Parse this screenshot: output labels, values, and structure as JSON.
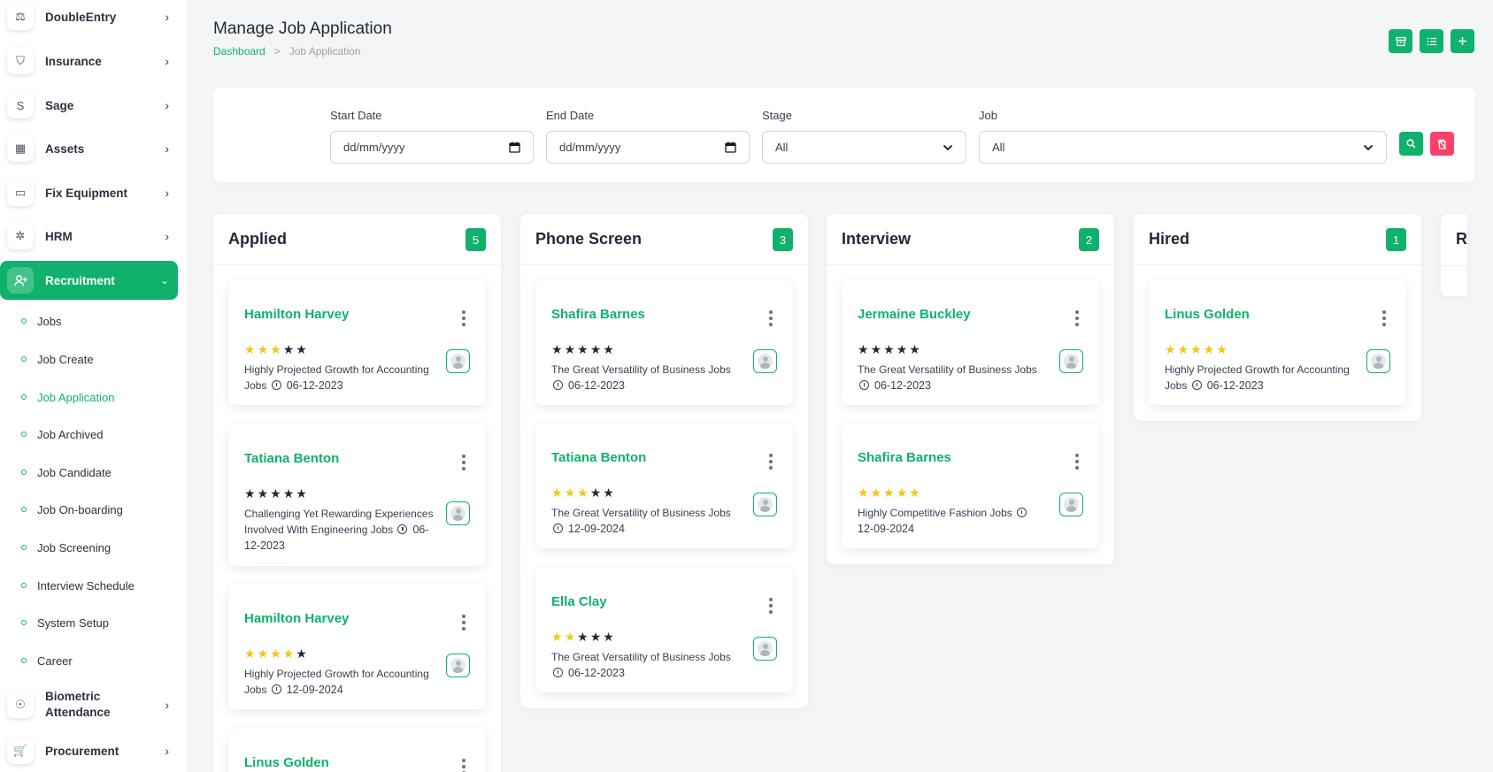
{
  "sidebar": {
    "items": [
      {
        "label": "DoubleEntry",
        "icon": "scale-icon",
        "glyph": "⚖"
      },
      {
        "label": "Insurance",
        "icon": "shield-icon",
        "glyph": "⛉"
      },
      {
        "label": "Sage",
        "icon": "sage-icon",
        "glyph": "S"
      },
      {
        "label": "Assets",
        "icon": "calculator-icon",
        "glyph": "▦"
      },
      {
        "label": "Fix Equipment",
        "icon": "archive-icon",
        "glyph": "▭"
      },
      {
        "label": "HRM",
        "icon": "network-icon",
        "glyph": "✲"
      },
      {
        "label": "Recruitment",
        "icon": "user-plus-icon",
        "glyph": "👤"
      }
    ],
    "recruitment_sub": [
      "Jobs",
      "Job Create",
      "Job Application",
      "Job Archived",
      "Job Candidate",
      "Job On-boarding",
      "Job Screening",
      "Interview Schedule",
      "System Setup",
      "Career"
    ],
    "active_sub": "Job Application",
    "bottom_items": [
      {
        "label": "Biometric Attendance",
        "icon": "fingerprint-icon",
        "glyph": "☉"
      },
      {
        "label": "Procurement",
        "icon": "cart-icon",
        "glyph": "🛒"
      }
    ]
  },
  "header": {
    "title": "Manage Job Application",
    "breadcrumb": {
      "link": "Dashboard",
      "separator": ">",
      "current": "Job Application"
    }
  },
  "filters": {
    "start_date": {
      "label": "Start Date",
      "placeholder": "dd/mm/yyyy"
    },
    "end_date": {
      "label": "End Date",
      "placeholder": "dd/mm/yyyy"
    },
    "stage": {
      "label": "Stage",
      "value": "All"
    },
    "job": {
      "label": "Job",
      "value": "All"
    }
  },
  "colors": {
    "accent": "#10b16c",
    "danger": "#fd3f6c",
    "star_on": "#f5c518",
    "star_off": "#1f2937"
  },
  "board": {
    "columns": [
      {
        "title": "Applied",
        "count": "5",
        "cards": [
          {
            "name": "Hamilton Harvey",
            "rating": 3,
            "desc": "Highly Projected Growth for Accounting Jobs",
            "date": "06-12-2023"
          },
          {
            "name": "Tatiana Benton",
            "rating": 0,
            "desc": "Challenging Yet Rewarding Experiences Involved With Engineering Jobs",
            "date": "06-12-2023"
          },
          {
            "name": "Hamilton Harvey",
            "rating": 4,
            "desc": "Highly Projected Growth for Accounting Jobs",
            "date": "12-09-2024"
          },
          {
            "name": "Linus Golden",
            "rating": 0,
            "desc": "",
            "date": ""
          }
        ]
      },
      {
        "title": "Phone Screen",
        "count": "3",
        "cards": [
          {
            "name": "Shafira Barnes",
            "rating": 0,
            "desc": "The Great Versatility of Business Jobs",
            "date": "06-12-2023"
          },
          {
            "name": "Tatiana Benton",
            "rating": 3,
            "desc": "The Great Versatility of Business Jobs",
            "date": "12-09-2024"
          },
          {
            "name": "Ella Clay",
            "rating": 2,
            "desc": "The Great Versatility of Business Jobs",
            "date": "06-12-2023"
          }
        ]
      },
      {
        "title": "Interview",
        "count": "2",
        "cards": [
          {
            "name": "Jermaine Buckley",
            "rating": 0,
            "desc": "The Great Versatility of Business Jobs",
            "date": "06-12-2023"
          },
          {
            "name": "Shafira Barnes",
            "rating": 5,
            "desc": "Highly Competitive Fashion Jobs",
            "date": "12-09-2024"
          }
        ]
      },
      {
        "title": "Hired",
        "count": "1",
        "cards": [
          {
            "name": "Linus Golden",
            "rating": 5,
            "desc": "Highly Projected Growth for Accounting Jobs",
            "date": "06-12-2023"
          }
        ]
      }
    ],
    "partial_column_title": "R"
  }
}
